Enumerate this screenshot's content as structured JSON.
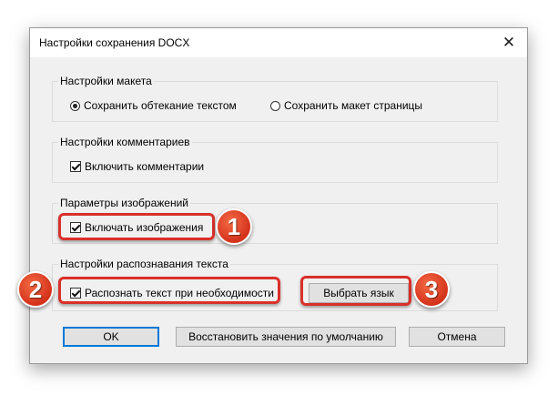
{
  "window": {
    "title": "Настройки сохранения DOCX",
    "close_glyph": "✕"
  },
  "layout_group": {
    "legend": "Настройки макета",
    "options": [
      {
        "label": "Сохранить обтекание текстом",
        "selected": true
      },
      {
        "label": "Сохранить макет страницы",
        "selected": false
      }
    ]
  },
  "comments_group": {
    "legend": "Настройки комментариев",
    "checkbox": {
      "label": "Включить комментарии",
      "checked": true
    }
  },
  "images_group": {
    "legend": "Параметры изображений",
    "checkbox": {
      "label": "Включать изображения",
      "checked": true
    }
  },
  "ocr_group": {
    "legend": "Настройки распознавания текста",
    "checkbox": {
      "label": "Распознать текст при необходимости",
      "checked": true
    },
    "language_button": "Выбрать язык"
  },
  "buttons": {
    "ok": "OK",
    "restore_defaults": "Восстановить значения по умолчанию",
    "cancel": "Отмена"
  },
  "annotations": {
    "badge1": "1",
    "badge2": "2",
    "badge3": "3",
    "highlight_color": "#d9302a",
    "default_button_border": "#0078d7"
  }
}
